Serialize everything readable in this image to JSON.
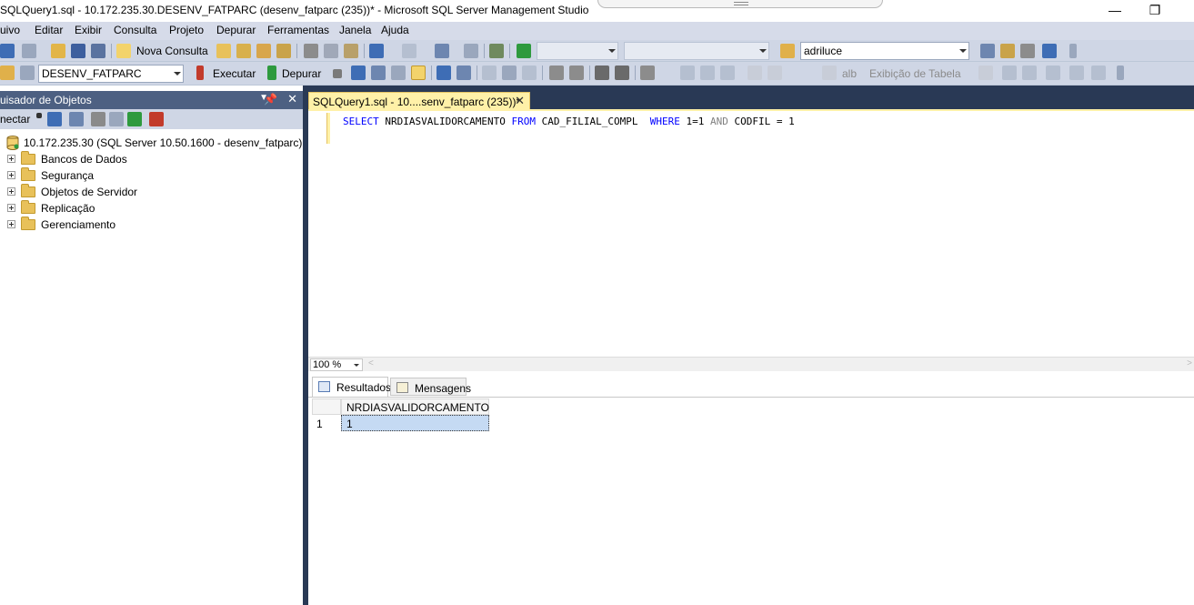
{
  "window": {
    "title": "SQLQuery1.sql - 10.172.235.30.DESENV_FATPARC (desenv_fatparc (235))* - Microsoft SQL Server Management Studio",
    "minimize": "—",
    "restore": "❐"
  },
  "menu": [
    "uivo",
    "Editar",
    "Exibir",
    "Consulta",
    "Projeto",
    "Depurar",
    "Ferramentas",
    "Janela",
    "Ajuda"
  ],
  "toolbar1": {
    "new_query": "Nova Consulta",
    "user_combo": "adriluce"
  },
  "toolbar2": {
    "database": "DESENV_FATPARC",
    "execute": "Executar",
    "debug": "Depurar",
    "table_view": "Exibição de Tabela"
  },
  "object_explorer": {
    "title": "uisador de Objetos",
    "connect": "nectar",
    "server": "10.172.235.30 (SQL Server 10.50.1600 - desenv_fatparc)",
    "nodes": [
      "Bancos de Dados",
      "Segurança",
      "Objetos de Servidor",
      "Replicação",
      "Gerenciamento"
    ]
  },
  "document": {
    "tab_title": "SQLQuery1.sql - 10....senv_fatparc (235))*",
    "sql": {
      "select": "SELECT",
      "column": " NRDIASVALIDORCAMENTO ",
      "from": "FROM",
      "table": " CAD_FILIAL_COMPL  ",
      "where": "WHERE",
      "cond1": " 1=1 ",
      "and": "AND",
      "cond2": " CODFIL = 1"
    },
    "zoom": "100 %"
  },
  "results": {
    "tabs": [
      "Resultados",
      "Mensagens"
    ],
    "columns": [
      "NRDIASVALIDORCAMENTO"
    ],
    "rows": [
      {
        "num": "1",
        "value": "1"
      }
    ]
  },
  "colors": {
    "frame": "#293955",
    "active_tab": "#fff1a8",
    "panel_header": "#4d6082",
    "keyword": "#0000ff"
  }
}
